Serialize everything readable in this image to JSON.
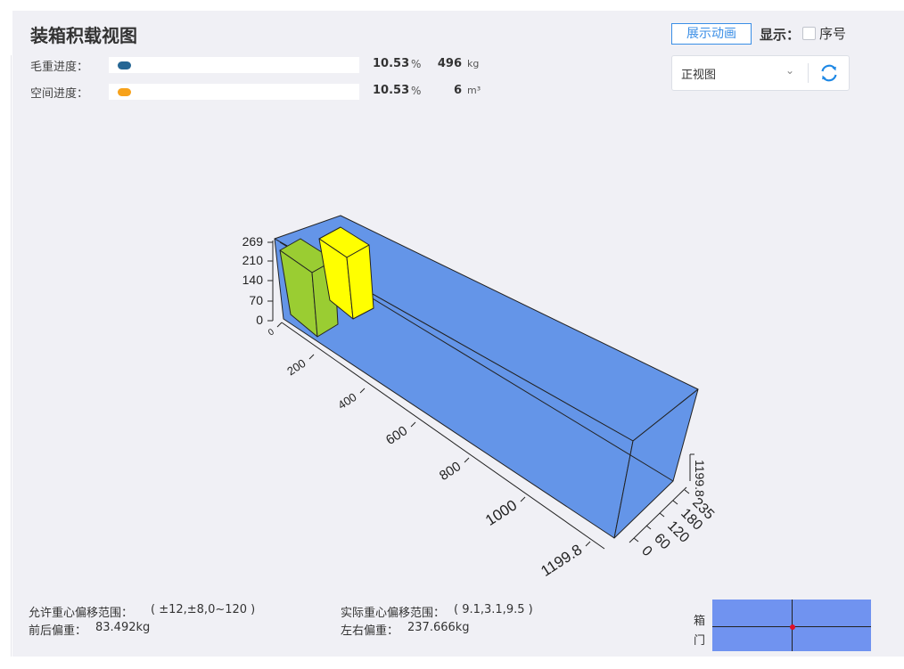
{
  "title": "装箱积载视图",
  "progress": {
    "weight": {
      "label": "毛重进度：",
      "percent_text": "10.53",
      "percent_unit": "%",
      "value_text": "496",
      "unit": "kg",
      "color": "#256694",
      "fraction": 0.1053
    },
    "space": {
      "label": "空间进度：",
      "percent_text": "10.53",
      "percent_unit": "%",
      "value_text": "6",
      "unit": "m³",
      "color": "#f7a21b",
      "fraction": 0.1053
    }
  },
  "toolbar": {
    "animate_label": "展示动画",
    "show_label": "显示：",
    "seq_label": "序号",
    "seq_checked": false,
    "view_selected": "正视图",
    "chevron_icon": "chevron-down-icon",
    "refresh_icon": "refresh-icon"
  },
  "chart_data": {
    "type": "3d-container-load",
    "container_color": "#6495e8",
    "cargo": [
      {
        "name": "",
        "color": "#9acd32"
      },
      {
        "name": "",
        "color": "#ffff00"
      }
    ],
    "z_ticks": [
      "269",
      "210",
      "140",
      "70",
      "0"
    ],
    "x_ticks": [
      "0",
      "200",
      "400",
      "600",
      "800",
      "1000",
      "1199.8"
    ],
    "y_ticks": [
      "0",
      "60",
      "120",
      "180",
      "235"
    ],
    "depth_tick": "1199.8"
  },
  "info": {
    "allowed_cg_label": "允许重心偏移范围：",
    "allowed_cg_value": "( ±12,±8,0~120 )",
    "actual_cg_label": "实际重心偏移范围：",
    "actual_cg_value": "( 9.1,3.1,9.5 )",
    "front_back_label": "前后偏重：",
    "front_back_value": "83.492kg",
    "left_right_label": "左右偏重：",
    "left_right_value": "237.666kg"
  },
  "door": {
    "label_top": "箱",
    "label_bottom": "门",
    "cg_dot_color": "#e0102a"
  }
}
